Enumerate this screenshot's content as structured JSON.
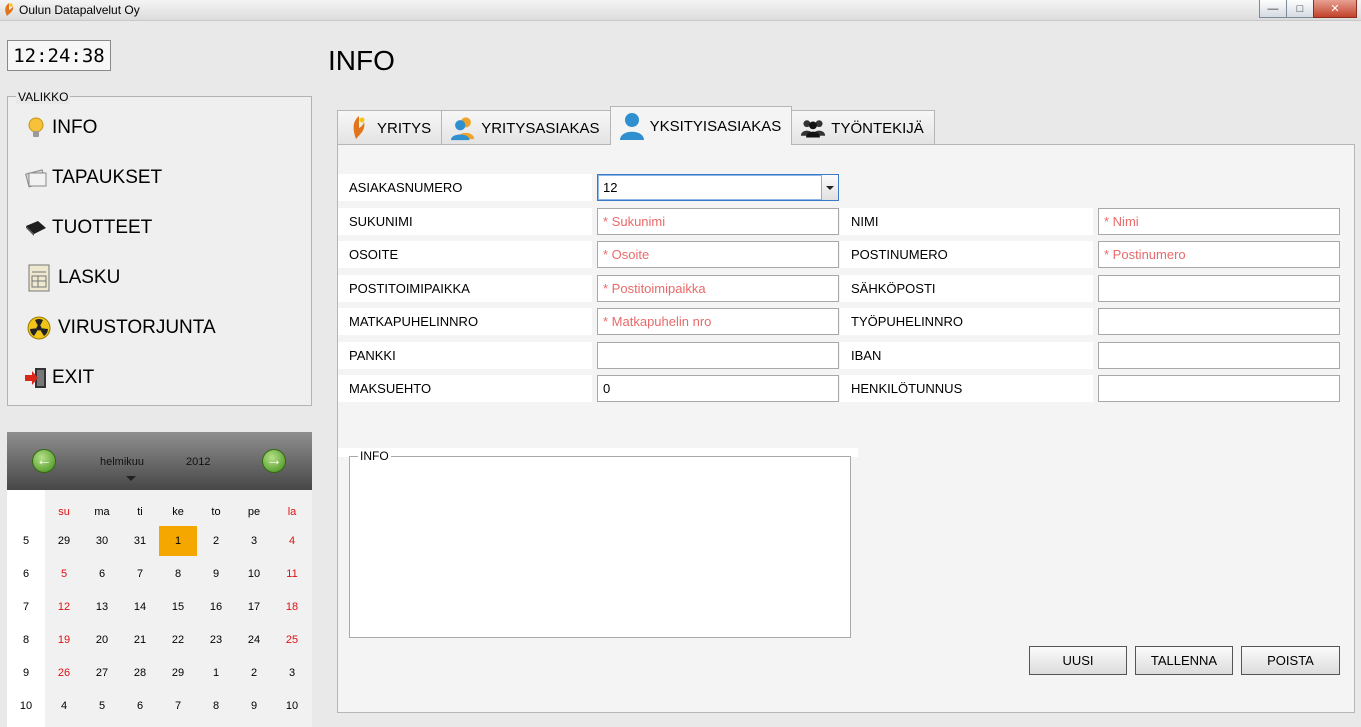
{
  "window": {
    "title": "Oulun Datapalvelut Oy",
    "minimize": "—",
    "maximize": "□",
    "close": "✕"
  },
  "clock": "12:24:38",
  "menu": {
    "legend": "VALIKKO",
    "items": [
      {
        "label": "INFO",
        "icon": "lightbulb-icon"
      },
      {
        "label": "TAPAUKSET",
        "icon": "papers-icon"
      },
      {
        "label": "TUOTTEET",
        "icon": "book-icon"
      },
      {
        "label": "LASKU",
        "icon": "invoice-icon"
      },
      {
        "label": "VIRUSTORJUNTA",
        "icon": "radiation-icon"
      },
      {
        "label": "EXIT",
        "icon": "exit-icon"
      }
    ]
  },
  "calendar": {
    "prev": "←",
    "next": "→",
    "month": "helmikuu",
    "year": "2012",
    "days_of_week": [
      "su",
      "ma",
      "ti",
      "ke",
      "to",
      "pe",
      "la"
    ],
    "weeks": [
      {
        "week": "5",
        "days": [
          "29",
          "30",
          "31",
          "1",
          "2",
          "3",
          "4"
        ]
      },
      {
        "week": "6",
        "days": [
          "5",
          "6",
          "7",
          "8",
          "9",
          "10",
          "11"
        ]
      },
      {
        "week": "7",
        "days": [
          "12",
          "13",
          "14",
          "15",
          "16",
          "17",
          "18"
        ]
      },
      {
        "week": "8",
        "days": [
          "19",
          "20",
          "21",
          "22",
          "23",
          "24",
          "25"
        ]
      },
      {
        "week": "9",
        "days": [
          "26",
          "27",
          "28",
          "29",
          "1",
          "2",
          "3"
        ]
      },
      {
        "week": "10",
        "days": [
          "4",
          "5",
          "6",
          "7",
          "8",
          "9",
          "10"
        ]
      }
    ],
    "highlight": "1"
  },
  "page_title": "INFO",
  "tabs": [
    {
      "label": "YRITYS",
      "icon": "company-logo-icon"
    },
    {
      "label": "YRITYSASIAKAS",
      "icon": "business-customer-icon"
    },
    {
      "label": "YKSITYISASIAKAS",
      "icon": "person-icon"
    },
    {
      "label": "TYÖNTEKIJÄ",
      "icon": "employees-icon"
    }
  ],
  "form": {
    "asiakasnumero": {
      "label": "ASIAKASNUMERO",
      "value": "12"
    },
    "sukunimi": {
      "label": "SUKUNIMI",
      "placeholder": "* Sukunimi"
    },
    "nimi": {
      "label": "NIMI",
      "placeholder": "* Nimi"
    },
    "osoite": {
      "label": "OSOITE",
      "placeholder": "* Osoite"
    },
    "postinumero": {
      "label": "POSTINUMERO",
      "placeholder": "* Postinumero"
    },
    "postitoimipaikka": {
      "label": "POSTITOIMIPAIKKA",
      "placeholder": "* Postitoimipaikka"
    },
    "sahkoposti": {
      "label": "SÄHKÖPOSTI",
      "value": ""
    },
    "matkapuhelinnro": {
      "label": "MATKAPUHELINNRO",
      "placeholder": "* Matkapuhelin nro"
    },
    "tyopuhelinnro": {
      "label": "TYÖPUHELINNRO",
      "value": ""
    },
    "pankki": {
      "label": "PANKKI",
      "value": ""
    },
    "iban": {
      "label": "IBAN",
      "value": ""
    },
    "maksuehto": {
      "label": "MAKSUEHTO",
      "value": "0"
    },
    "henkilotunnus": {
      "label": "HENKILÖTUNNUS",
      "value": ""
    },
    "info": {
      "legend": "INFO",
      "value": ""
    }
  },
  "buttons": {
    "new": "UUSI",
    "save": "TALLENNA",
    "delete": "POISTA"
  },
  "colors": {
    "today": "#f5a700",
    "weekend": "#dd1111",
    "placeholder": "#e86a6a",
    "focus": "#3b79c9"
  }
}
